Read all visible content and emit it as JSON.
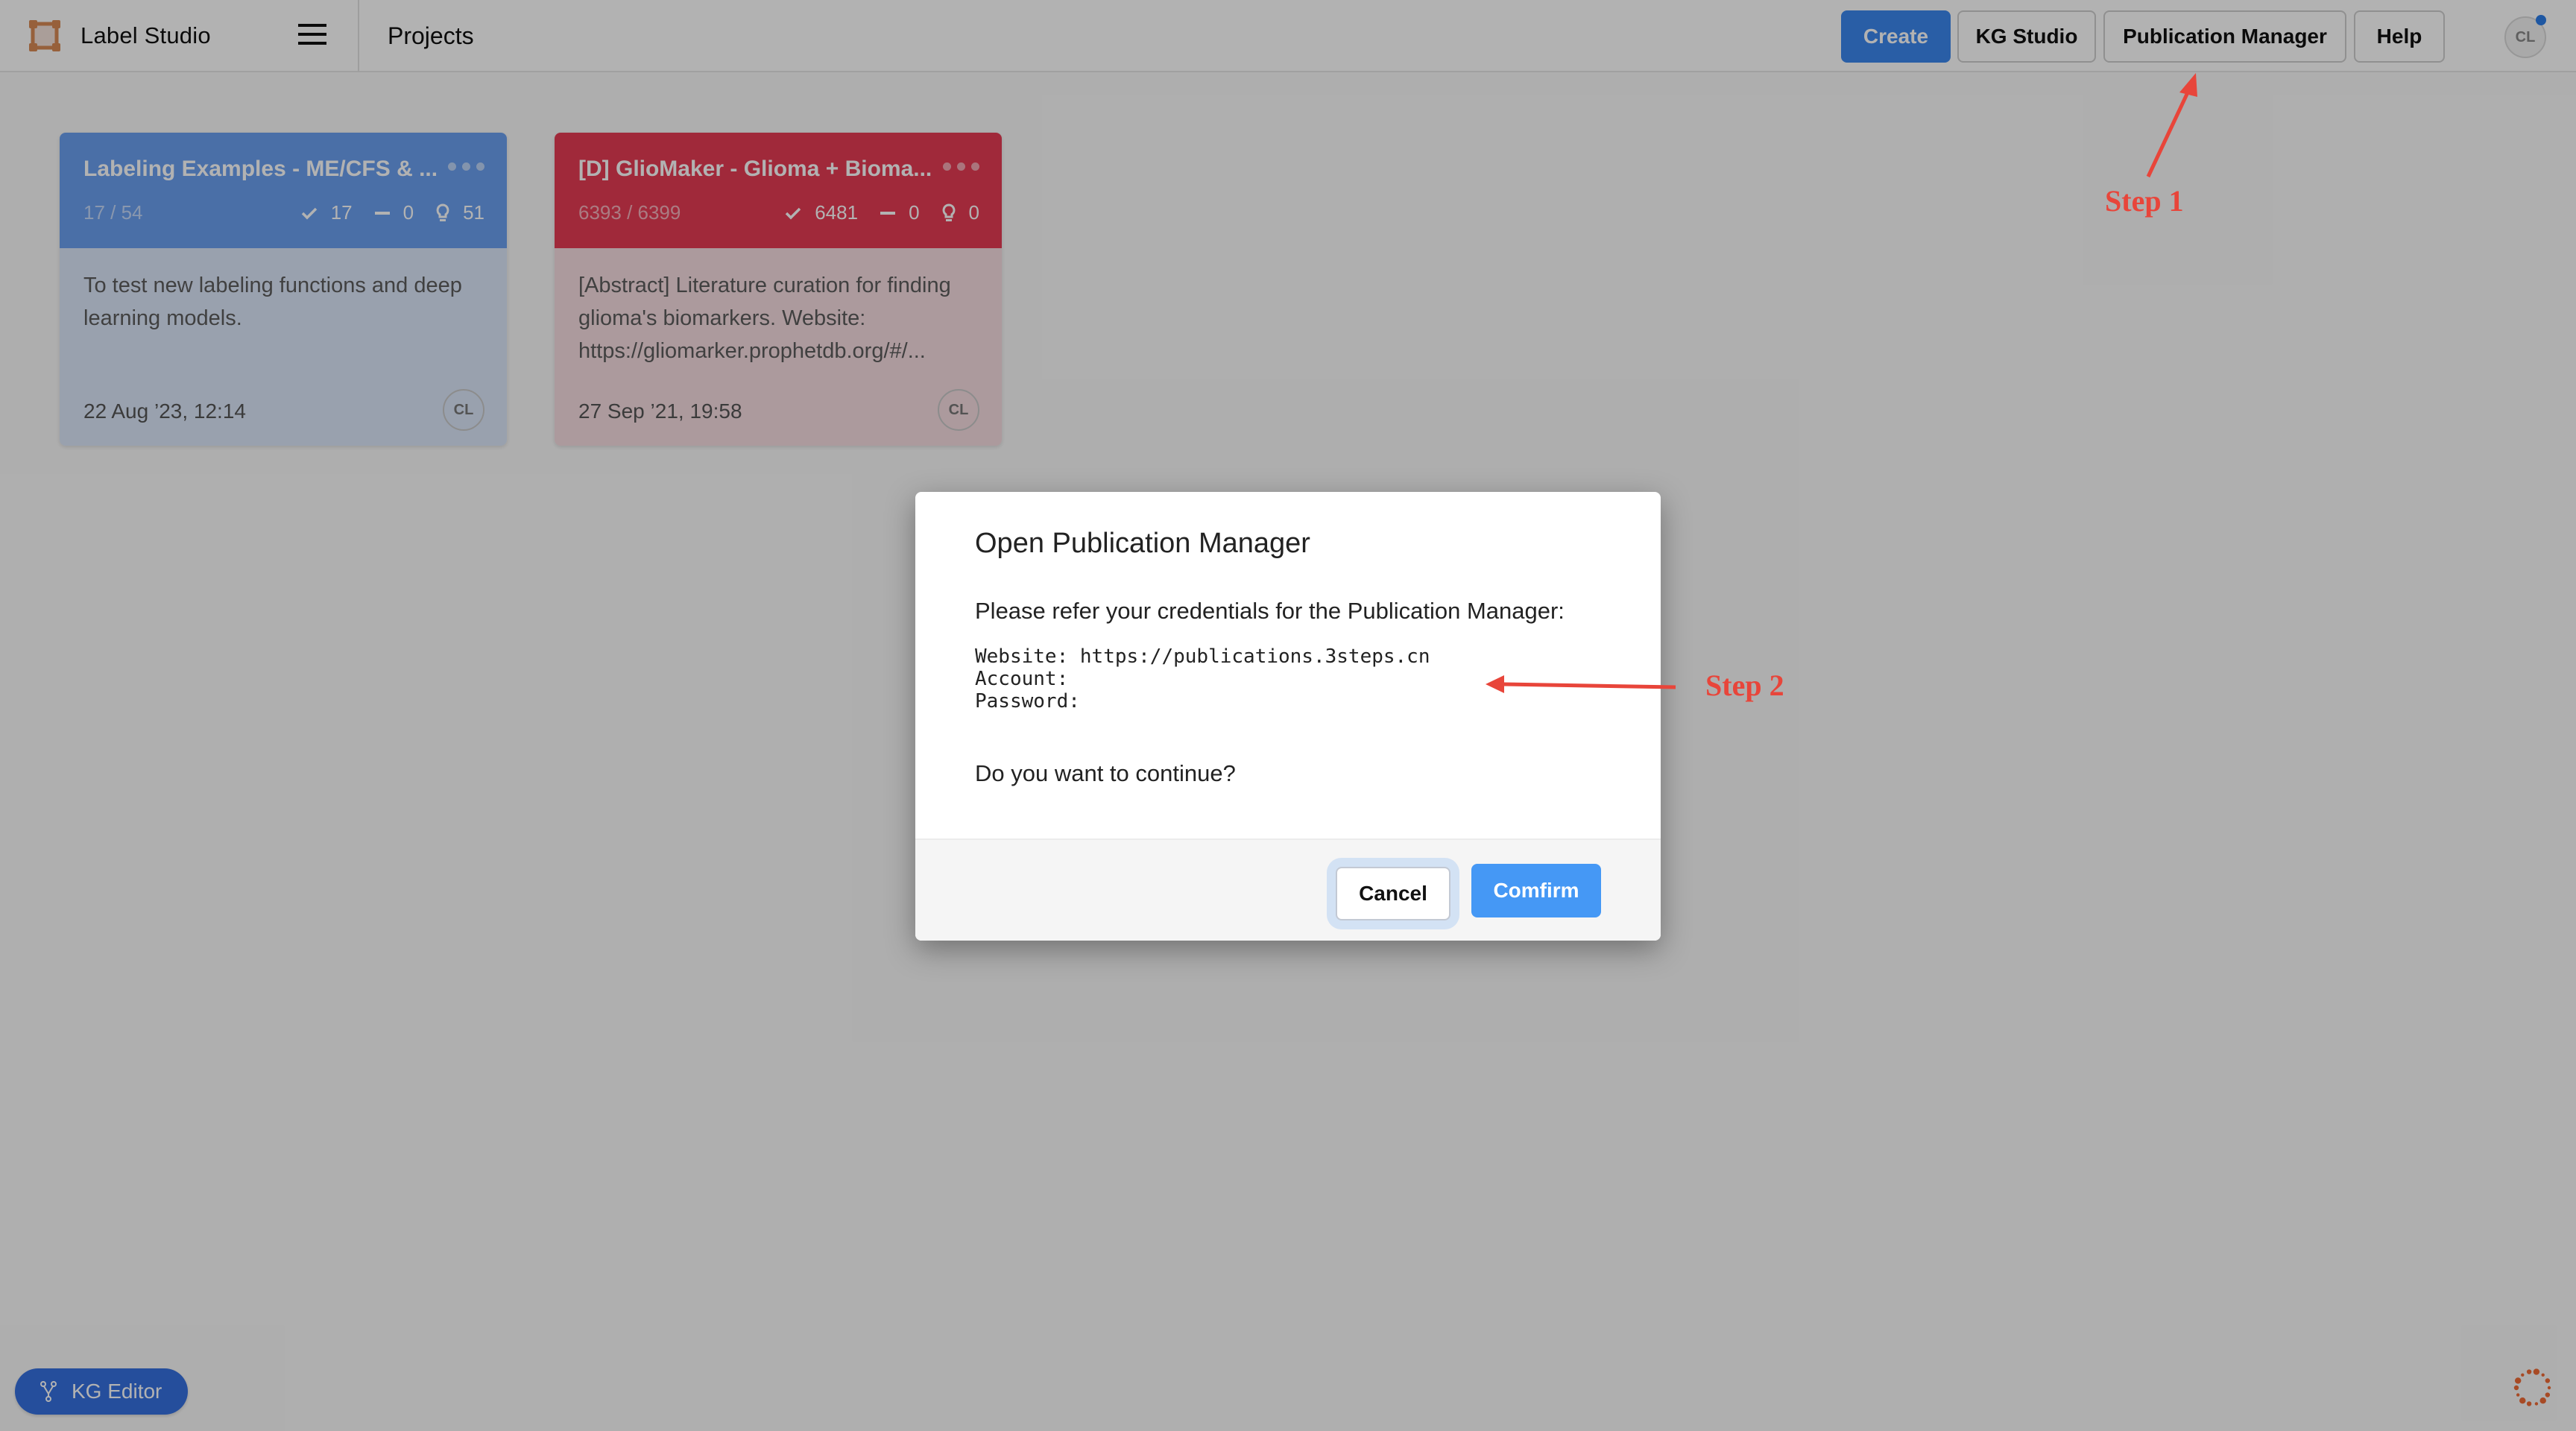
{
  "header": {
    "brand": "Label Studio",
    "page_title": "Projects",
    "buttons": {
      "create": "Create",
      "kg_studio": "KG Studio",
      "publication_manager": "Publication Manager",
      "help": "Help"
    },
    "avatar_initials": "CL",
    "icons": {
      "logo": "label-studio-logo-icon",
      "menu": "hamburger-menu-icon"
    }
  },
  "projects": [
    {
      "title": "Labeling Examples - ME/CFS & ...",
      "progress": "17 / 54",
      "completed": "17",
      "skipped": "0",
      "predictions": "51",
      "description": "To test new labeling functions and deep learning models.",
      "date": "22 Aug ’23, 12:14",
      "owner_initials": "CL",
      "color": "#6b9fef"
    },
    {
      "title": "[D] GlioMaker - Glioma + Bioma...",
      "progress": "6393 / 6399",
      "completed": "6481",
      "skipped": "0",
      "predictions": "0",
      "description": "[Abstract] Literature curation for finding glioma's biomarkers. Website: https://gliomarker.prophetdb.org/#/...",
      "date": "27 Sep ’21, 19:58",
      "owner_initials": "CL",
      "color": "#e63c54"
    }
  ],
  "modal": {
    "title": "Open Publication Manager",
    "intro": "Please refer your credentials for the Publication Manager:",
    "credentials": {
      "website_label": "Website:",
      "website_value": "https://publications.3steps.cn",
      "account_label": "Account:",
      "password_label": "Password:"
    },
    "question": "Do you want to continue?",
    "cancel_label": "Cancel",
    "confirm_label": "Comfirm"
  },
  "annotations": {
    "step1": "Step 1",
    "step2": "Step 2",
    "color": "#e8453a"
  },
  "kg_editor": {
    "label": "KG Editor",
    "icon": "branch-fork-icon"
  },
  "colors": {
    "primary": "#3b87ee",
    "confirm": "#4598f5",
    "kg_editor": "#3670e0"
  }
}
